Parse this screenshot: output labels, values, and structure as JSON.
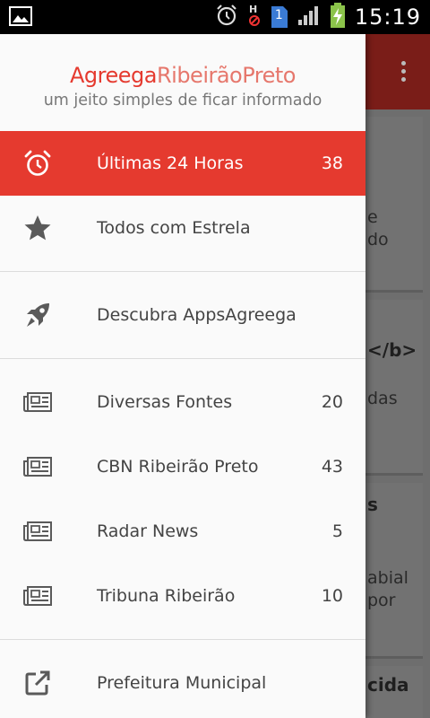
{
  "status_bar": {
    "time": "15:19",
    "network_badge": "1",
    "icons": [
      "gallery-icon",
      "alarm-icon",
      "hplus-icon",
      "sim-icon",
      "signal-icon",
      "battery-charging-icon"
    ]
  },
  "background": {
    "fragments": [
      "e",
      "do",
      "</b>",
      "das",
      "s",
      "abial",
      "por",
      "cida"
    ]
  },
  "drawer": {
    "brand": {
      "part1": "Agreega",
      "part2": "RibeirãoPreto",
      "tagline": "um jeito simples de ficar informado"
    },
    "items": [
      {
        "label": "Últimas 24 Horas",
        "count": "38",
        "icon": "alarm-clock-icon",
        "active": true
      },
      {
        "label": "Todos com Estrela",
        "count": "",
        "icon": "star-icon"
      },
      {
        "label": "Descubra AppsAgreega",
        "count": "",
        "icon": "rocket-icon"
      },
      {
        "label": "Diversas Fontes",
        "count": "20",
        "icon": "newspaper-icon"
      },
      {
        "label": "CBN Ribeirão Preto",
        "count": "43",
        "icon": "newspaper-icon"
      },
      {
        "label": "Radar News",
        "count": "5",
        "icon": "newspaper-icon"
      },
      {
        "label": "Tribuna Ribeirão",
        "count": "10",
        "icon": "newspaper-icon"
      },
      {
        "label": "Prefeitura Municipal",
        "count": "",
        "icon": "external-link-icon"
      }
    ]
  },
  "colors": {
    "accent": "#e53a2f",
    "toolbar_dimmed": "#7a1d18"
  }
}
